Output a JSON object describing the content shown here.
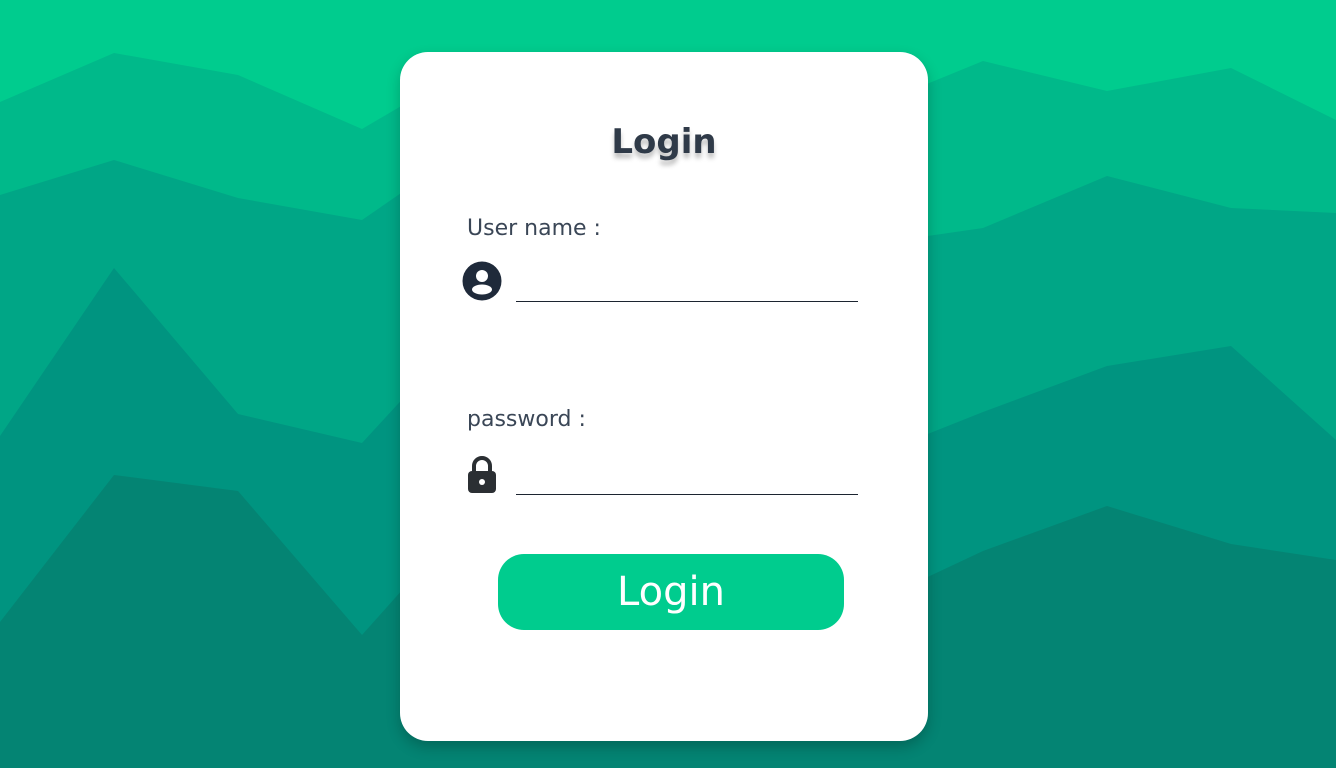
{
  "page": {
    "title": "Login"
  },
  "form": {
    "username": {
      "label": "User name :",
      "icon": "user-circle-icon",
      "value": "",
      "placeholder": ""
    },
    "password": {
      "label": "password :",
      "icon": "lock-icon",
      "value": "",
      "placeholder": ""
    },
    "submit_label": "Login"
  },
  "colors": {
    "accent": "#00cc8e",
    "text_dark": "#2f3a48",
    "mountain_layers": [
      "#00cc8e",
      "#00b98a",
      "#00a686",
      "#009480",
      "#048473"
    ]
  }
}
